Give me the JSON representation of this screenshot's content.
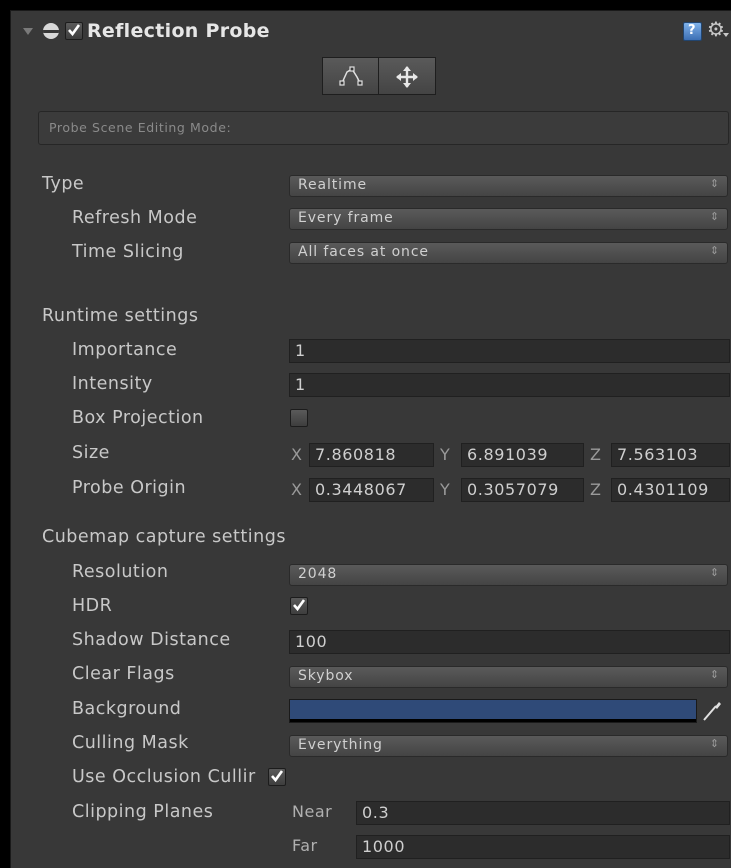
{
  "component": {
    "title": "Reflection Probe",
    "enabled": true,
    "fold_icon": "foldout-triangle-icon",
    "component_icon": "reflection-probe-icon",
    "help_icon": "help-book-icon",
    "settings_icon": "gear-icon"
  },
  "edit_mode": {
    "buttons": [
      "edit-bounds-icon",
      "move-origin-icon"
    ],
    "label": "Probe Scene Editing Mode:"
  },
  "type": {
    "label": "Type",
    "value": "Realtime"
  },
  "refresh_mode": {
    "label": "Refresh Mode",
    "value": "Every frame"
  },
  "time_slicing": {
    "label": "Time Slicing",
    "value": "All faces at once"
  },
  "runtime": {
    "heading": "Runtime settings",
    "importance": {
      "label": "Importance",
      "value": "1"
    },
    "intensity": {
      "label": "Intensity",
      "value": "1"
    },
    "box_projection": {
      "label": "Box Projection",
      "checked": false
    },
    "size": {
      "label": "Size",
      "x_label": "X",
      "x": "7.860818",
      "y_label": "Y",
      "y": "6.891039",
      "z_label": "Z",
      "z": "7.563103"
    },
    "probe_origin": {
      "label": "Probe Origin",
      "x_label": "X",
      "x": "0.3448067",
      "y_label": "Y",
      "y": "0.3057079",
      "z_label": "Z",
      "z": "0.4301109"
    }
  },
  "cubemap": {
    "heading": "Cubemap capture settings",
    "resolution": {
      "label": "Resolution",
      "value": "2048"
    },
    "hdr": {
      "label": "HDR",
      "checked": true
    },
    "shadow_distance": {
      "label": "Shadow Distance",
      "value": "100"
    },
    "clear_flags": {
      "label": "Clear Flags",
      "value": "Skybox"
    },
    "background": {
      "label": "Background",
      "color": "#2f4a78"
    },
    "culling_mask": {
      "label": "Culling Mask",
      "value": "Everything"
    },
    "use_occlusion": {
      "label": "Use Occlusion Cullir",
      "checked": true
    },
    "clipping": {
      "label": "Clipping Planes",
      "near_label": "Near",
      "near": "0.3",
      "far_label": "Far",
      "far": "1000"
    }
  },
  "colors": {
    "panel": "#383838",
    "field": "#2c2c2c",
    "text": "#c8c8c8",
    "accent": "#3c6fb4"
  }
}
